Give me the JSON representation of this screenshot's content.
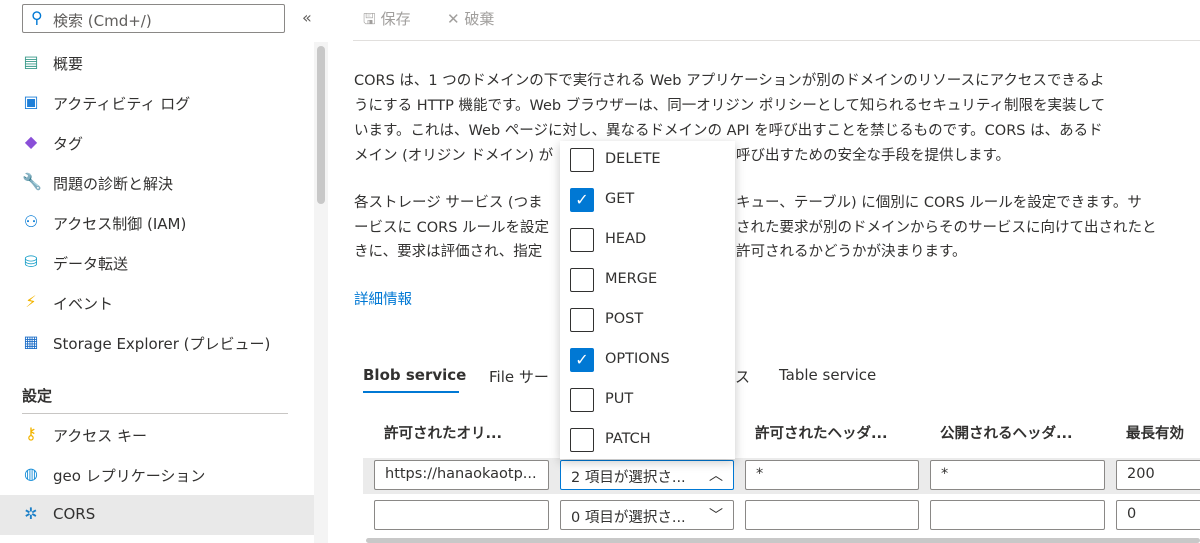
{
  "sidebar": {
    "search_placeholder": "検索 (Cmd+/)",
    "collapse_icon": "«",
    "items": [
      {
        "label": "概要",
        "icon": "overview-icon"
      },
      {
        "label": "アクティビティ ログ",
        "icon": "activity-log-icon"
      },
      {
        "label": "タグ",
        "icon": "tag-icon"
      },
      {
        "label": "問題の診断と解決",
        "icon": "wrench-icon"
      },
      {
        "label": "アクセス制御 (IAM)",
        "icon": "people-icon"
      },
      {
        "label": "データ転送",
        "icon": "data-transfer-icon"
      },
      {
        "label": "イベント",
        "icon": "lightning-icon"
      },
      {
        "label": "Storage Explorer (プレビュー)",
        "icon": "storage-explorer-icon"
      }
    ],
    "section_title": "設定",
    "settings_items": [
      {
        "label": "アクセス キー",
        "icon": "key-icon"
      },
      {
        "label": "geo レプリケーション",
        "icon": "globe-icon"
      },
      {
        "label": "CORS",
        "icon": "cors-icon",
        "selected": true
      }
    ]
  },
  "toolbar": {
    "save": "保存",
    "discard": "破棄"
  },
  "description": {
    "p1": [
      "CORS は、1 つのドメインの下で実行される Web アプリケーションが別のドメインのリソースにアクセスできるよ",
      "うにする HTTP 機能です。Web ブラウザーは、同一オリジン ポリシーとして知られるセキュリティ制限を実装して",
      "います。これは、Web ページに対し、異なるドメインの API を呼び出すことを禁じるものです。CORS は、あるド"
    ],
    "p1_last_left": "メイン (オリジン ドメイン) が",
    "p1_last_right": "呼び出すための安全な手段を提供します。",
    "p2_left": [
      "各ストレージ サービス (つま",
      "ービスに CORS ルールを設定",
      "きに、要求は評価され、指定"
    ],
    "p2_right": [
      "キュー、テーブル) に個別に CORS ルールを設定できます。サ",
      "された要求が別のドメインからそのサービスに向けて出されたと",
      "許可されるかどうかが決まります。"
    ],
    "learn_more": "詳細情報"
  },
  "tabs": {
    "blob": "Blob service",
    "file_partial": "File サー",
    "queue_partial": "ス",
    "table": "Table service"
  },
  "table": {
    "headers": [
      "許可されたオリ...",
      "許可されたヘッダ...",
      "公開されるヘッダ...",
      "最長有効"
    ],
    "rows": [
      {
        "origin": "https://hanaokaotp...",
        "methods": "2 項目が選択さ...",
        "allowed_headers": "*",
        "exposed_headers": "*",
        "max_age": "200"
      },
      {
        "origin": "",
        "methods": "0 項目が選択さ...",
        "allowed_headers": "",
        "exposed_headers": "",
        "max_age": "0"
      }
    ]
  },
  "methods_dropdown": [
    {
      "label": "DELETE",
      "checked": false
    },
    {
      "label": "GET",
      "checked": true
    },
    {
      "label": "HEAD",
      "checked": false
    },
    {
      "label": "MERGE",
      "checked": false
    },
    {
      "label": "POST",
      "checked": false
    },
    {
      "label": "OPTIONS",
      "checked": true
    },
    {
      "label": "PUT",
      "checked": false
    },
    {
      "label": "PATCH",
      "checked": false
    }
  ],
  "colors": {
    "accent": "#0078d4",
    "selected_bg": "#e9e9e9"
  }
}
